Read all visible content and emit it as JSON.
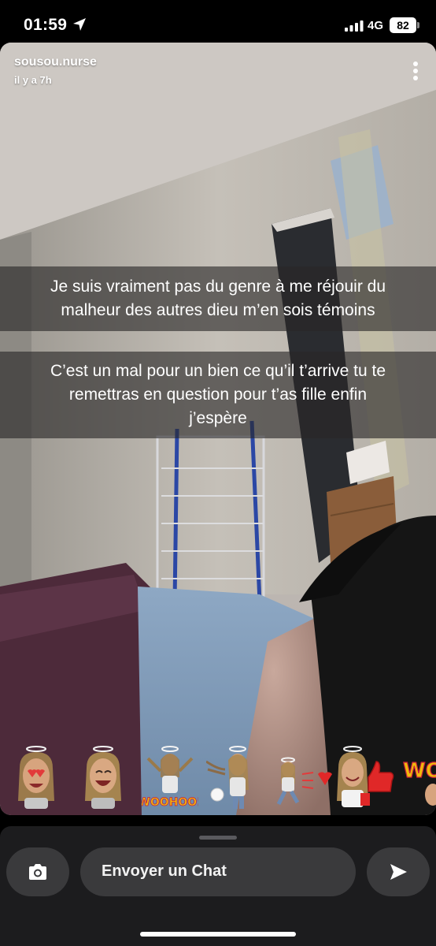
{
  "status_bar": {
    "time": "01:59",
    "network": "4G",
    "battery": "82",
    "icons": [
      "location-arrow-icon",
      "signal-bars-icon"
    ]
  },
  "snap": {
    "sender": "sousou.nurse",
    "time_ago": "il y a 7h",
    "menu_icon": "more-vertical-icon",
    "captions": [
      {
        "lines": [
          "Je suis vraiment pas du genre à me réjouir du",
          "malheur des autres dieu m’en sois témoins"
        ]
      },
      {
        "lines": [
          "C’est un mal pour un bien ce qu’il t’arrive tu te",
          "remettras en question pour t’as fille enfin",
          "j’espère"
        ]
      }
    ],
    "stickers": [
      {
        "icon": "bitmoji-heart-eyes-icon"
      },
      {
        "icon": "bitmoji-laughing-icon"
      },
      {
        "icon": "bitmoji-woohoo-icon",
        "text": "WOOHOO!"
      },
      {
        "icon": "bitmoji-toilet-paper-icon"
      },
      {
        "icon": "bitmoji-running-heart-icon"
      },
      {
        "icon": "bitmoji-thumbs-up-icon"
      },
      {
        "icon": "bitmoji-wow-icon",
        "text": "WO"
      }
    ]
  },
  "chat_bar": {
    "placeholder": "Envoyer un Chat",
    "camera_icon": "camera-icon",
    "send_icon": "send-arrow-icon"
  }
}
